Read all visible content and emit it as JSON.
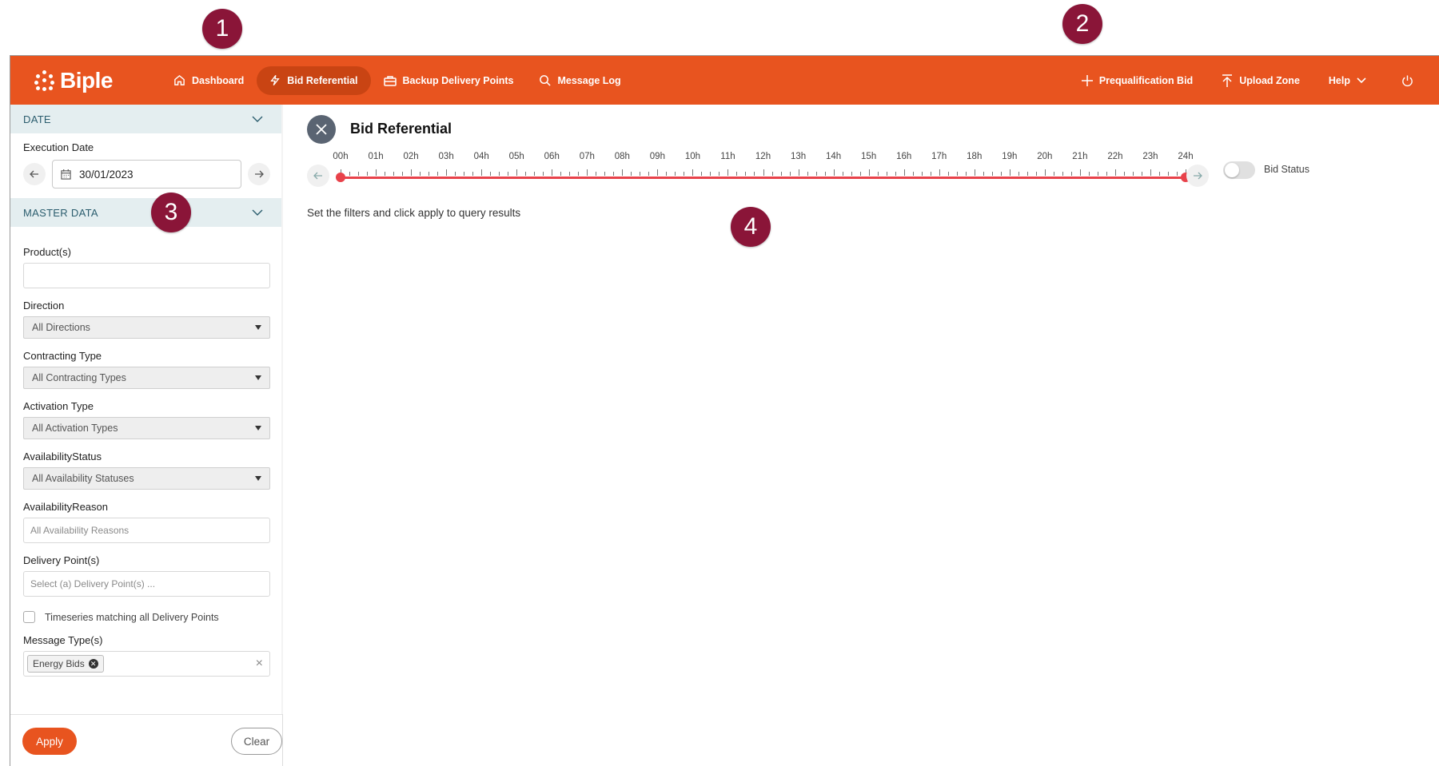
{
  "annotations": [
    "1",
    "2",
    "3",
    "4"
  ],
  "brand": {
    "name": "Biple",
    "color": "#e8541f",
    "active_nav_color": "#c94413"
  },
  "nav": {
    "items": [
      {
        "label": "Dashboard",
        "icon": "home-icon"
      },
      {
        "label": "Bid Referential",
        "icon": "lightning-icon",
        "active": true
      },
      {
        "label": "Backup Delivery Points",
        "icon": "briefcase-icon"
      },
      {
        "label": "Message Log",
        "icon": "search-icon"
      }
    ],
    "right": [
      {
        "label": "Prequalification Bid",
        "icon": "plus-icon"
      },
      {
        "label": "Upload Zone",
        "icon": "upload-icon"
      },
      {
        "label": "Help",
        "icon": "chevron-down-icon"
      }
    ],
    "power_icon": "power-icon"
  },
  "sidebar": {
    "date_section": {
      "title": "DATE",
      "execution_date_label": "Execution Date",
      "execution_date_value": "30/01/2023"
    },
    "master_section": {
      "title": "MASTER DATA",
      "products_label": "Product(s)",
      "direction_label": "Direction",
      "direction_value": "All Directions",
      "contracting_label": "Contracting Type",
      "contracting_value": "All Contracting Types",
      "activation_label": "Activation Type",
      "activation_value": "All Activation Types",
      "availability_status_label": "AvailabilityStatus",
      "availability_status_value": "All Availability Statuses",
      "availability_reason_label": "AvailabilityReason",
      "availability_reason_placeholder": "All Availability Reasons",
      "delivery_points_label": "Delivery Point(s)",
      "delivery_points_placeholder": "Select (a) Delivery Point(s) ...",
      "timeseries_checkbox_label": "Timeseries matching all Delivery Points",
      "message_types_label": "Message Type(s)",
      "message_types_tags": [
        "Energy Bids"
      ]
    },
    "apply_label": "Apply",
    "clear_label": "Clear"
  },
  "main": {
    "title": "Bid Referential",
    "hours": [
      "00h",
      "01h",
      "02h",
      "03h",
      "04h",
      "05h",
      "06h",
      "07h",
      "08h",
      "09h",
      "10h",
      "11h",
      "12h",
      "13h",
      "14h",
      "15h",
      "16h",
      "17h",
      "18h",
      "19h",
      "20h",
      "21h",
      "22h",
      "23h",
      "24h"
    ],
    "range_start": "00h",
    "range_end": "24h",
    "toggle_label": "Bid Status",
    "toggle_on": false,
    "info_text": "Set the filters and click apply to query results"
  }
}
